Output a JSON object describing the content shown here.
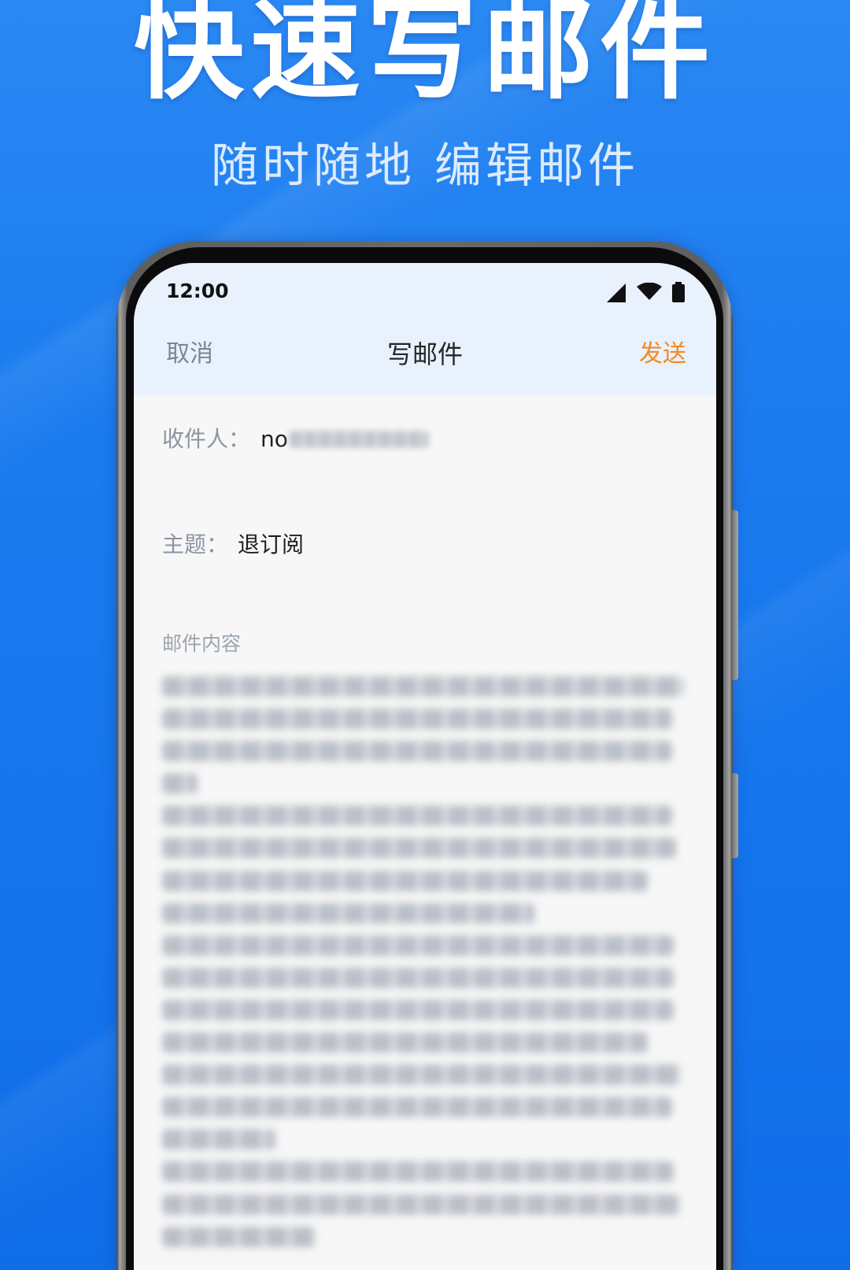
{
  "hero": {
    "title": "快速写邮件",
    "subtitle": "随时随地 编辑邮件"
  },
  "status_bar": {
    "time": "12:00",
    "icons": {
      "signal": "signal-icon",
      "wifi": "wifi-icon",
      "battery": "battery-icon"
    }
  },
  "header": {
    "cancel_label": "取消",
    "title": "写邮件",
    "send_label": "发送"
  },
  "compose": {
    "recipient": {
      "label": "收件人：",
      "value": "no"
    },
    "subject": {
      "label": "主题：",
      "value": "退订阅"
    },
    "body": {
      "label": "邮件内容"
    }
  },
  "colors": {
    "background": "#1a7bef",
    "header_bg": "#e8f1fc",
    "content_bg": "#f7f7f7",
    "send_accent": "#f28a1e",
    "label_gray": "#8b95a3"
  }
}
